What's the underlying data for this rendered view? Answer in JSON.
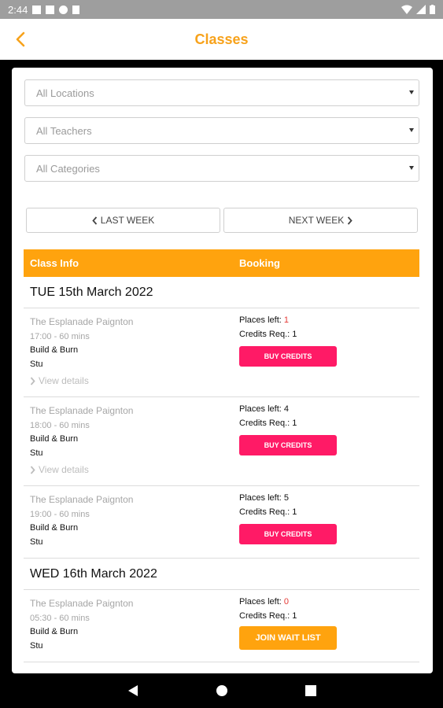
{
  "status_bar": {
    "time": "2:44",
    "icons": [
      "notification-icon",
      "notification-icon",
      "sync-icon",
      "sd-card-icon"
    ],
    "right_icons": [
      "wifi-icon",
      "signal-icon",
      "battery-icon"
    ]
  },
  "app_bar": {
    "title": "Classes",
    "back_icon": "chevron-left-icon",
    "accent_color": "#f7a21b"
  },
  "filters": {
    "locations": "All Locations",
    "teachers": "All Teachers",
    "categories": "All Categories"
  },
  "week_nav": {
    "prev_label": "LAST WEEK",
    "next_label": "NEXT WEEK"
  },
  "table": {
    "col_info": "Class Info",
    "col_booking": "Booking",
    "header_color": "#ffa30e"
  },
  "days": [
    {
      "label": "TUE 15th March 2022"
    },
    {
      "label": "WED 16th March 2022"
    }
  ],
  "classes": [
    {
      "location": "The Esplanade Paignton",
      "time": "17:00 - 60 mins",
      "name": "Build & Burn",
      "teacher": "Stu",
      "details": "View details",
      "places_label": "Places left: ",
      "places": "1",
      "credits_label": "Credits Req.: ",
      "credits": "1",
      "button": "BUY CREDITS"
    },
    {
      "location": "The Esplanade Paignton",
      "time": "18:00 - 60 mins",
      "name": "Build & Burn",
      "teacher": "Stu",
      "details": "View details",
      "places_label": "Places left: ",
      "places": "4",
      "credits_label": "Credits Req.: ",
      "credits": "1",
      "button": "BUY CREDITS"
    },
    {
      "location": "The Esplanade Paignton",
      "time": "19:00 - 60 mins",
      "name": "Build & Burn",
      "teacher": "Stu",
      "places_label": "Places left: ",
      "places": "5",
      "credits_label": "Credits Req.: ",
      "credits": "1",
      "button": "BUY CREDITS"
    },
    {
      "location": "The Esplanade Paignton",
      "time": "05:30 - 60 mins",
      "name": "Build & Burn",
      "teacher": "Stu",
      "places_label": "Places left: ",
      "places": "0",
      "credits_label": "Credits Req.: ",
      "credits": "1",
      "button": "JOIN WAIT LIST"
    }
  ],
  "colors": {
    "buy_button": "#ff1a66",
    "wait_button": "#ffa30e",
    "low_places": "#e53935"
  },
  "nav_bar": {
    "icons": [
      "back-triangle-icon",
      "home-circle-icon",
      "recents-square-icon"
    ]
  }
}
